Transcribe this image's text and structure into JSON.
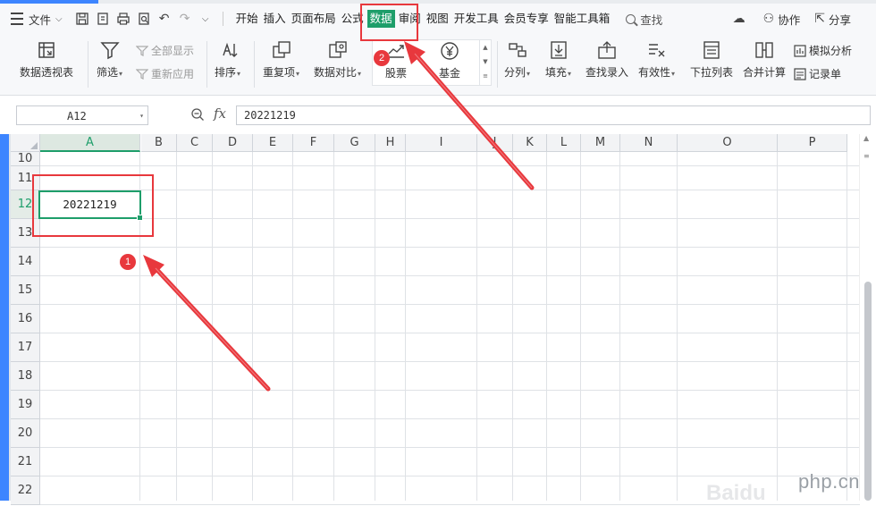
{
  "menubar": {
    "file_label": "文件",
    "tabs": [
      "开始",
      "插入",
      "页面布局",
      "公式",
      "数据",
      "审阅",
      "视图",
      "开发工具",
      "会员专享",
      "智能工具箱"
    ],
    "active_tab": "数据",
    "search_label": "查找",
    "collab_label": "协作",
    "share_label": "分享"
  },
  "ribbon": {
    "pivot": "数据透视表",
    "filter": "筛选",
    "show_all": "全部显示",
    "reapply": "重新应用",
    "sort": "排序",
    "duplicates": "重复项",
    "compare": "数据对比",
    "stock": "股票",
    "fund": "基金",
    "split": "分列",
    "fill": "填充",
    "lookup": "查找录入",
    "validity": "有效性",
    "dropdown_list": "下拉列表",
    "merge_calc": "合并计算",
    "simulate": "模拟分析",
    "record_sheet": "记录单"
  },
  "formula_bar": {
    "cell_ref": "A12",
    "fx_label": "fx",
    "value": "20221219"
  },
  "grid": {
    "columns": [
      "A",
      "B",
      "C",
      "D",
      "E",
      "F",
      "G",
      "H",
      "I",
      "J",
      "K",
      "L",
      "M",
      "N",
      "O",
      "P"
    ],
    "rows": [
      "10",
      "11",
      "12",
      "13",
      "14",
      "15",
      "16",
      "17",
      "18",
      "19",
      "20",
      "21",
      "22"
    ],
    "selected_column": "A",
    "selected_row": "12",
    "active_cell_value": "20221219"
  },
  "annotations": {
    "badge_1": "1",
    "badge_2": "2",
    "highlight_color": "#e8383d"
  },
  "watermark": "php.cn",
  "watermark_baidu": "Baidu",
  "colors": {
    "accent_green": "#1e9e6a",
    "accent_blue": "#3d85ff"
  }
}
